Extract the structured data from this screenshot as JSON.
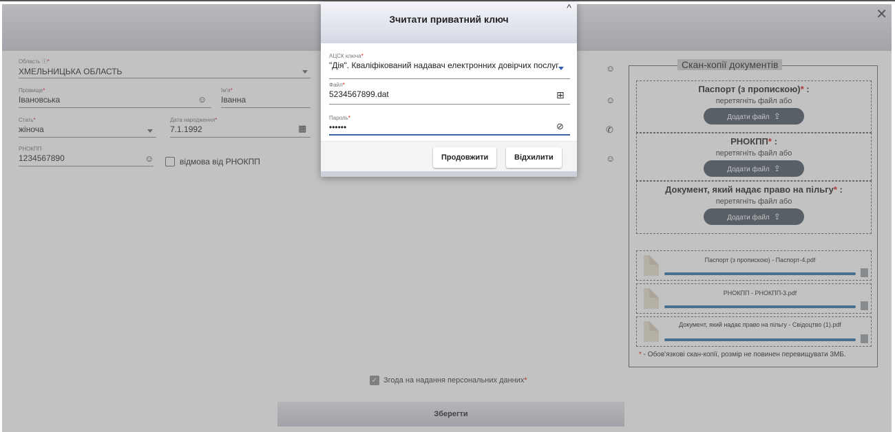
{
  "form": {
    "region_label": "Область",
    "region_info": "ⓘ",
    "region_req": "*",
    "region_value": "ХМЕЛЬНИЦЬКА ОБЛАСТЬ",
    "surname_label": "Прізвище",
    "surname_value": "Івановська",
    "name_label": "Ім'я",
    "name_value": "Іванна",
    "gender_label": "Стать",
    "gender_value": "жіноча",
    "birthdate_label": "Дата народження",
    "birthdate_value": "7.1.1992",
    "rnokpp_label": "РНОКПП",
    "rnokpp_value": "1234567890",
    "rnokpp_refusal_label": "відмова від РНОКПП",
    "req": "*"
  },
  "scan_panel": {
    "title": "Скан-копії документів",
    "zones": [
      {
        "title": "Паспорт (з пропискою)",
        "req": "*",
        "suffix": " :",
        "hint": "перетягніть файл або",
        "button": "Додати файл"
      },
      {
        "title": "РНОКПП",
        "req": "*",
        "suffix": " :",
        "hint": "перетягніть файл або",
        "button": "Додати файл"
      },
      {
        "title": "Документ, який надає право на пільгу",
        "req": "*",
        "suffix": " :",
        "hint": "перетягніть файл або",
        "button": "Додати файл"
      }
    ],
    "files": [
      {
        "name": "Паспорт (з пропискою) - Паспорт-4.pdf",
        "progress": 1.0
      },
      {
        "name": "РНОКПП - РНОКПП-3.pdf",
        "progress": 1.0
      },
      {
        "name": "Документ, який надає право на пільгу - Свідоцтво (1).pdf",
        "progress": 1.0
      }
    ],
    "note_star": "*",
    "note": " - Обов'язкові скан-копії, розмір не повинен перевищувати 3МБ."
  },
  "consent": {
    "label": "Згода на надання персональних данних",
    "req": "*",
    "checked": true
  },
  "save_button": "Зберегти",
  "close_glyph": "✕",
  "dialog": {
    "title": "Зчитати приватний ключ",
    "chevron": "^",
    "acsk_label": "АЦСК ключа",
    "acsk_value": "\"Дія\". Кваліфікований надавач електронних довірчих послуг",
    "file_label": "Файл",
    "file_value": "5234567899.dat",
    "password_label": "Пароль",
    "password_value": "••••••",
    "continue_button": "Продовжити",
    "reject_button": "Відхилити"
  },
  "colors": {
    "accent": "#2f6ea8",
    "required": "#d11111",
    "add_button": "#4b5563"
  }
}
